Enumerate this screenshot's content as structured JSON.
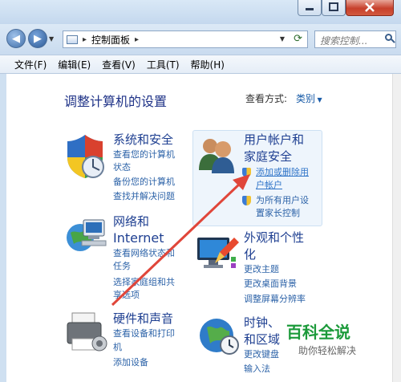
{
  "addressbar": {
    "breadcrumb": "控制面板",
    "search_placeholder": "搜索控制..."
  },
  "menubar": {
    "items": [
      "文件(F)",
      "编辑(E)",
      "查看(V)",
      "工具(T)",
      "帮助(H)"
    ]
  },
  "main": {
    "heading": "调整计算机的设置",
    "view_by_label": "查看方式:",
    "view_by_value": "类别"
  },
  "categories": {
    "system": {
      "title": "系统和安全",
      "links": [
        "查看您的计算机",
        "状态",
        "备份您的计算机",
        "查找并解决问题"
      ]
    },
    "network": {
      "title_1": "网络和",
      "title_2": "Internet",
      "links": [
        "查看网络状态和",
        "任务",
        "选择家庭组和共",
        "享选项"
      ]
    },
    "hardware": {
      "title": "硬件和声音",
      "links": [
        "查看设备和打印",
        "机",
        "添加设备"
      ]
    },
    "users": {
      "title_1": "用户帐户和",
      "title_2": "家庭安全",
      "links": [
        "添加或删除用",
        "户帐户",
        "为所有用户设",
        "置家长控制"
      ]
    },
    "appearance": {
      "title_1": "外观和个性",
      "title_2": "化",
      "links": [
        "更改主题",
        "更改桌面背景",
        "调整屏幕分辨率"
      ]
    },
    "clock": {
      "title_1": "时钟、",
      "title_2": "和区域",
      "links": [
        "更改键盘",
        "输入法"
      ]
    }
  },
  "watermark": {
    "title": "百科全说",
    "subtitle": "助你轻松解决"
  },
  "colors": {
    "link": "#2d63a8",
    "title": "#1e3f91",
    "arrow": "#e0463a",
    "watermark": "#1b9a3a"
  }
}
